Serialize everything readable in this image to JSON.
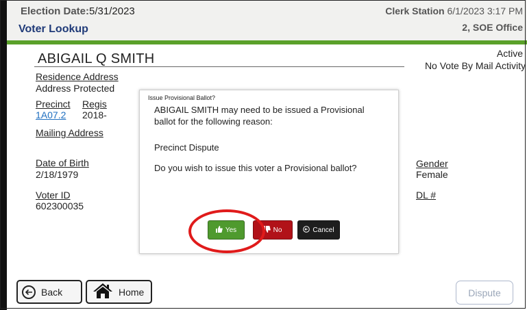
{
  "header": {
    "election_label": "Election Date:",
    "election_date": "5/31/2023",
    "screen_title": "Voter Lookup",
    "clerk_label": "Clerk Station",
    "datetime": "6/1/2023 3:17 PM",
    "office": "2, SOE Office"
  },
  "voter": {
    "name": "ABIGAIL Q SMITH",
    "status": "Active",
    "vbm_status": "No Vote By Mail Activity",
    "residence_label": "Residence Address",
    "residence_value": "Address Protected",
    "precinct_label": "Precinct",
    "precinct_value": "1A07.2",
    "registration_label_partial": "Regis",
    "registration_value_partial": "2018-",
    "mailing_label": "Mailing Address",
    "dob_label": "Date of Birth",
    "dob_value": "2/18/1979",
    "voterid_label": "Voter ID",
    "voterid_value": "602300035",
    "gender_label": "Gender",
    "gender_value": "Female",
    "dl_label": "DL #"
  },
  "dialog": {
    "title": "Issue Provisional Ballot?",
    "message": "ABIGAIL SMITH may need to be issued a Provisional ballot for the following reason:",
    "reason": "Precinct Dispute",
    "question": "Do you wish to issue this voter a Provisional ballot?",
    "yes_label": "Yes",
    "no_label": "No",
    "cancel_label": "Cancel"
  },
  "footer": {
    "back_label": "Back",
    "home_label": "Home",
    "dispute_label": "Dispute"
  },
  "colors": {
    "accent_green": "#5aa12a",
    "title_blue": "#1f3a78",
    "yes_green": "#4f9a2e",
    "no_red": "#b11219",
    "highlight_red": "#e01b1b"
  }
}
